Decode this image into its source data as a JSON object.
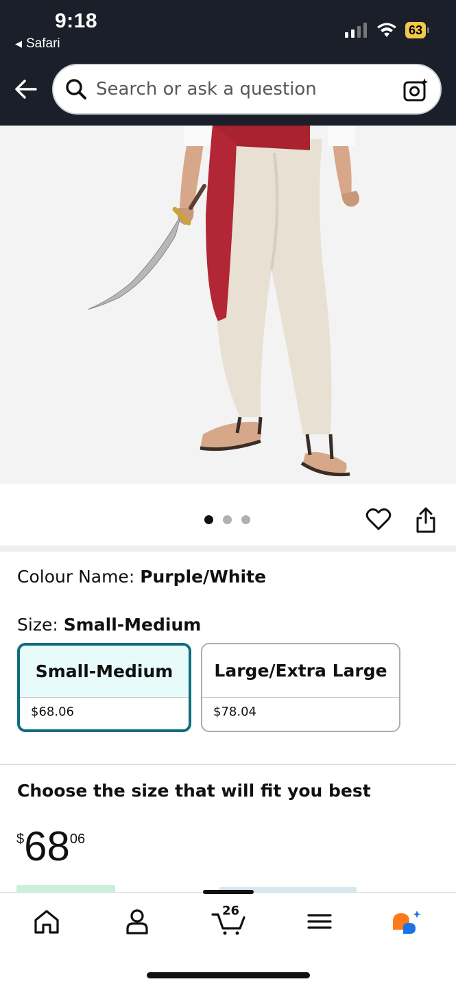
{
  "status_bar": {
    "time": "9:18",
    "back_app": "Safari",
    "battery": "63"
  },
  "search": {
    "placeholder": "Search or ask a question"
  },
  "gallery": {
    "image_alt": "Costume with red sash, cream trousers, sandals and curved sword",
    "dots_total": 3,
    "active_dot": 0
  },
  "variation": {
    "colour_label": "Colour Name: ",
    "colour_value": "Purple/White",
    "size_label": "Size: ",
    "size_value": "Small-Medium",
    "options": [
      {
        "name": "Small-Medium",
        "price": "$68.06",
        "selected": true
      },
      {
        "name": "Large/Extra Large",
        "price": "$78.04",
        "selected": false
      }
    ]
  },
  "fit": {
    "heading": "Choose the size that will fit you best"
  },
  "price": {
    "currency": "$",
    "whole": "68",
    "fraction": "06"
  },
  "bottom_nav": {
    "cart_count": "26",
    "items": [
      "home-icon",
      "account-icon",
      "cart-icon",
      "menu-icon",
      "rufus-icon"
    ]
  },
  "colors": {
    "header_bg": "#1b1f2a",
    "selected_border": "#0d6e7e",
    "selected_fill": "#e8fbfb",
    "rufus_orange": "#ff7a1a",
    "rufus_blue": "#1a73e8"
  }
}
